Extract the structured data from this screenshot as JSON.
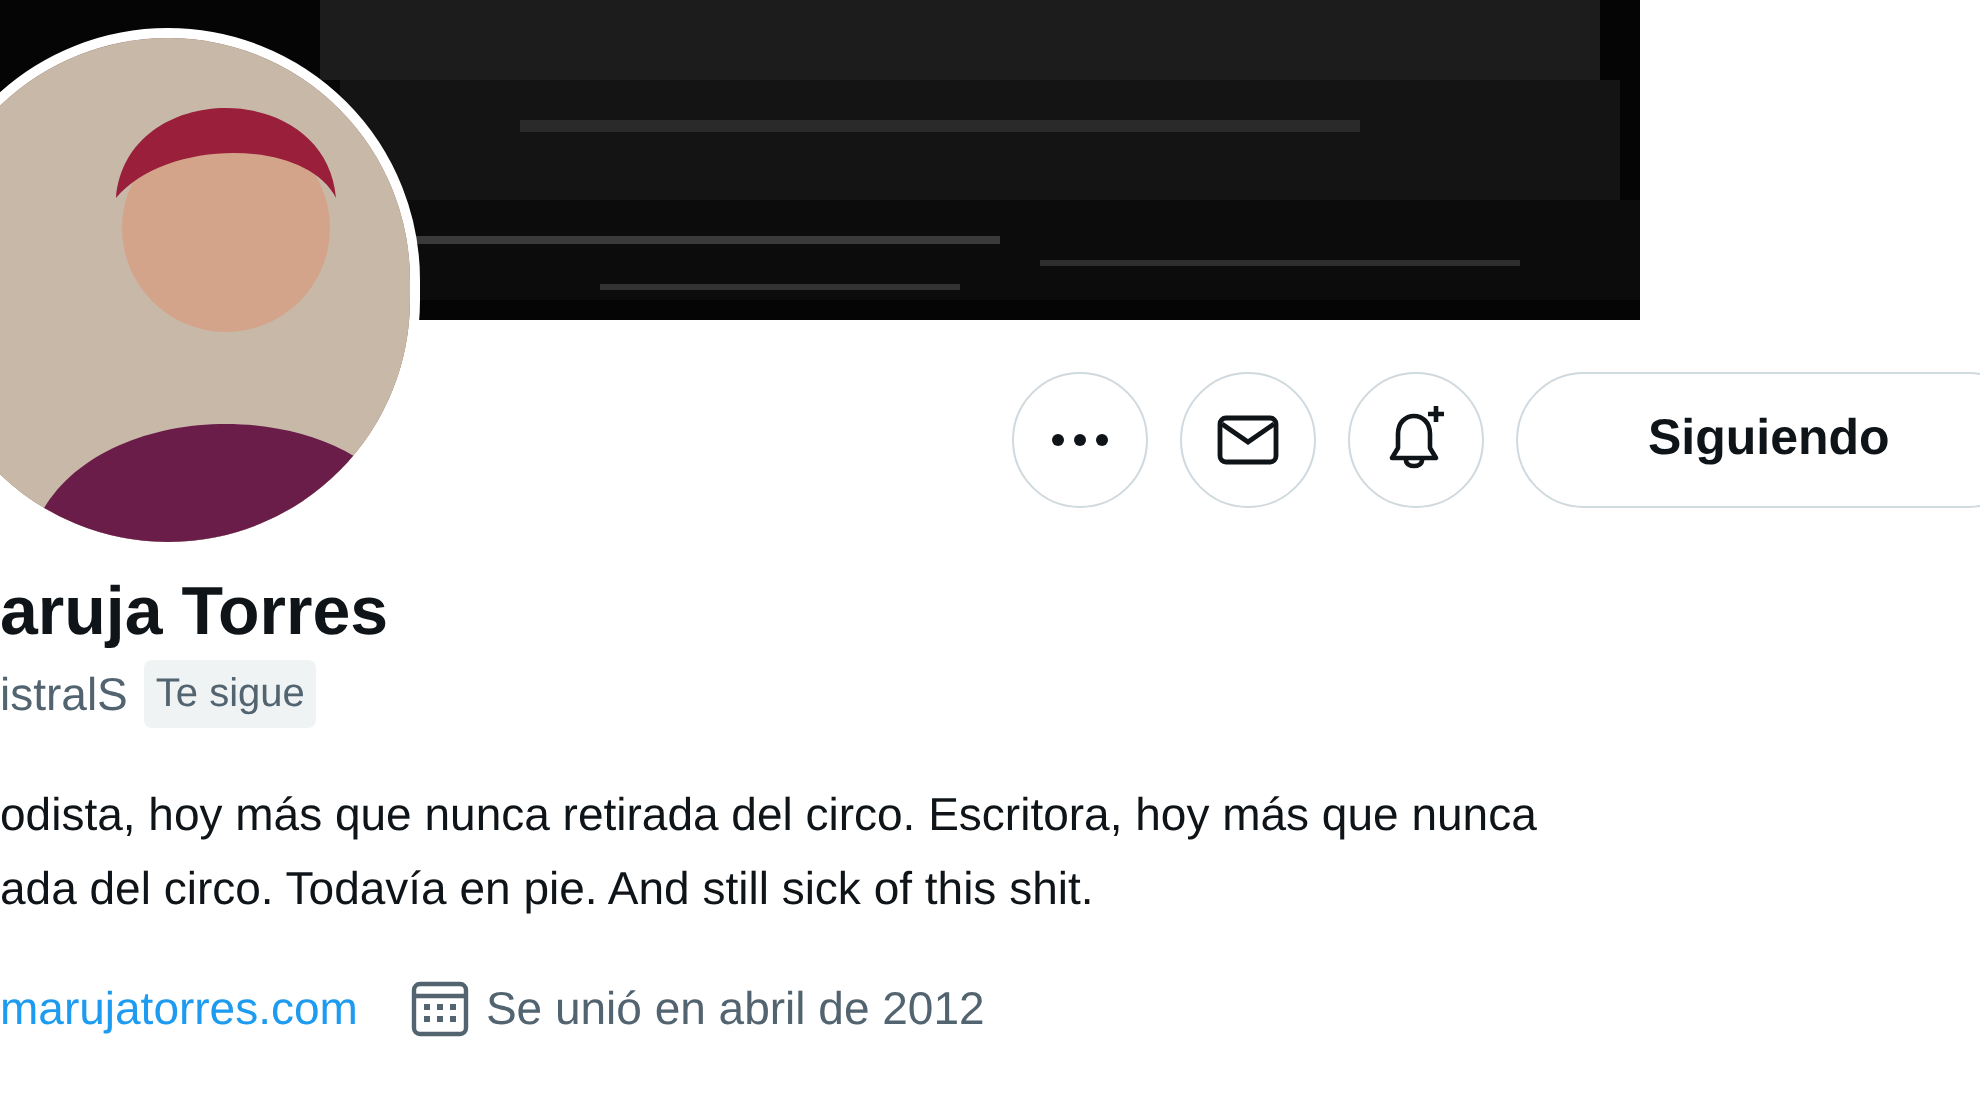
{
  "banner": {
    "kind": "picture"
  },
  "actions": [
    {
      "kind": "more"
    },
    {
      "kind": "message"
    },
    {
      "kind": "notify"
    }
  ],
  "follow_button": {
    "label": "Siguiendo"
  },
  "profile": {
    "name": "aruja Torres",
    "handle": "istralS",
    "follows_you": "Te sigue"
  },
  "bio": [
    "odista, hoy más que nunca retirada del circo. Escritora, hoy más que nunca",
    "ada del circo. Todavía en pie. And still sick of this shit."
  ],
  "meta": {
    "website": "marujatorres.com",
    "joined": "Se unió en abril de 2012"
  }
}
